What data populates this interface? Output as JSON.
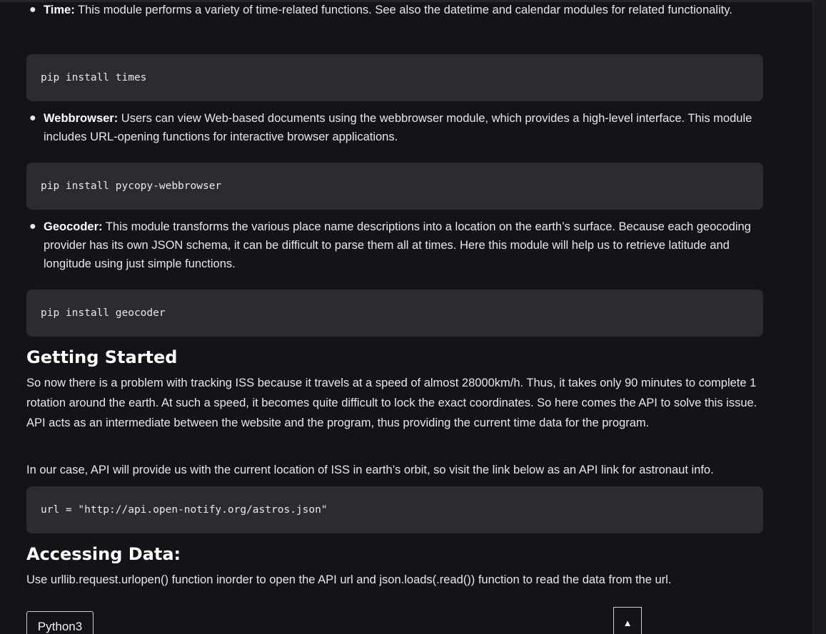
{
  "bullets": [
    {
      "term": "Time:",
      "desc": " This module performs a variety of time-related functions. See also the datetime and calendar modules for related functionality.",
      "code": "pip install times"
    },
    {
      "term": "Webbrowser:",
      "desc": " Users can view Web-based documents using the webbrowser module, which provides a high-level interface. This module includes URL-opening functions for interactive browser applications.",
      "code": "pip install pycopy-webbrowser"
    },
    {
      "term": "Geocoder:",
      "desc": " This module transforms the various place name descriptions into a location on the earth’s surface. Because each geocoding provider has its own JSON schema, it can be difficult to parse them all at times. Here this module will help us to retrieve latitude and longitude using just simple functions.",
      "code": "pip install geocoder"
    }
  ],
  "getting_started": {
    "heading": "Getting Started",
    "para1": "So now there is a problem with tracking ISS because it travels at a speed of almost 28000km/h. Thus, it takes only 90 minutes to complete 1 rotation around the earth. At such a speed, it becomes quite difficult to lock the exact coordinates. So here comes the API to solve this issue. API acts as an intermediate between the website and the program, thus providing the current time data for the program.",
    "para2": "In our case, API will provide us with the current location of ISS in earth’s orbit, so visit the link below as an API link for astronaut info.",
    "code": "url = \"http://api.open-notify.org/astros.json\""
  },
  "accessing_data": {
    "heading": "Accessing Data:",
    "para": "Use urllib.request.urlopen() function inorder to open the API url and json.loads(.read()) function to read the data from the url."
  },
  "tab_label": "Python3",
  "scroll_top_glyph": "▲"
}
